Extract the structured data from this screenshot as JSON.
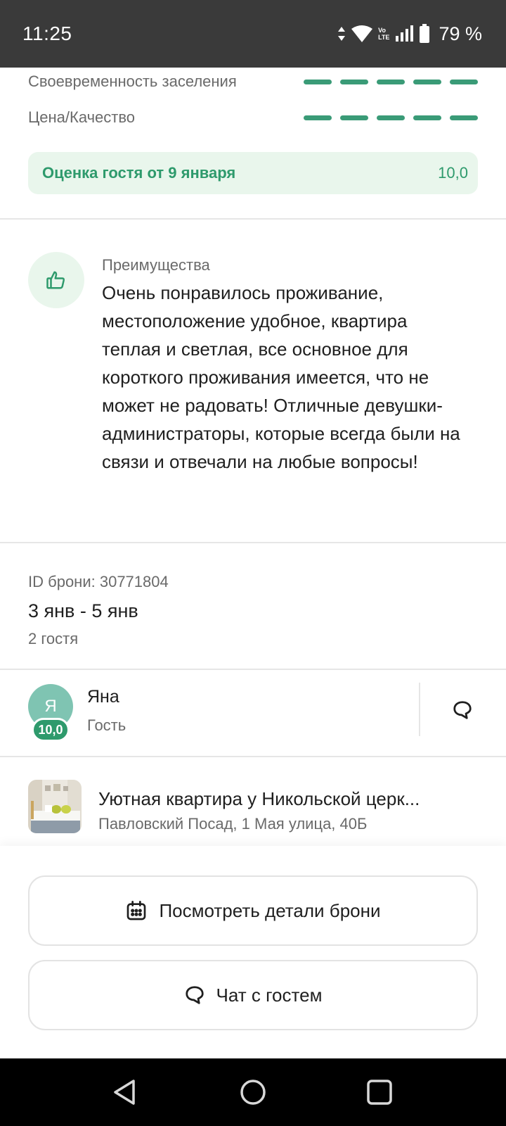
{
  "status": {
    "time": "11:25",
    "battery": "79 %",
    "lte_top": "Vo",
    "lte_bottom": "LTE"
  },
  "ratings": [
    {
      "label": "Своевременность заселения",
      "score": 5,
      "max": 5
    },
    {
      "label": "Цена/Качество",
      "score": 5,
      "max": 5
    }
  ],
  "guest_score": {
    "label": "Оценка гостя от 9 января",
    "value": "10,0"
  },
  "advantages": {
    "label": "Преимущества",
    "text": "Очень понравилось проживание, местоположение удобное, квартира теплая и светлая, все основное для короткого проживания имеется, что не может не радовать! Отличные девушки-администраторы, которые всегда были на связи и отвечали на любые вопросы!"
  },
  "booking": {
    "id": "ID брони: 30771804",
    "dates": "3 янв - 5 янв",
    "guests": "2 гостя"
  },
  "guest": {
    "initial": "Я",
    "score": "10,0",
    "name": "Яна",
    "role": "Гость"
  },
  "property": {
    "title": "Уютная квартира у Никольской церк...",
    "address": "Павловский Посад, 1 Мая улица, 40Б"
  },
  "actions": {
    "details": "Посмотреть детали брони",
    "chat": "Чат с гостем"
  },
  "colors": {
    "accent": "#2e9a6c",
    "accent_light": "#e9f6ec",
    "status_bar": "#3a3a3a"
  },
  "icons": [
    "thumbs-up-icon",
    "chat-bubble-icon",
    "calendar-icon",
    "back-icon",
    "home-icon",
    "recents-icon",
    "wifi-icon",
    "signal-icon",
    "battery-icon"
  ]
}
